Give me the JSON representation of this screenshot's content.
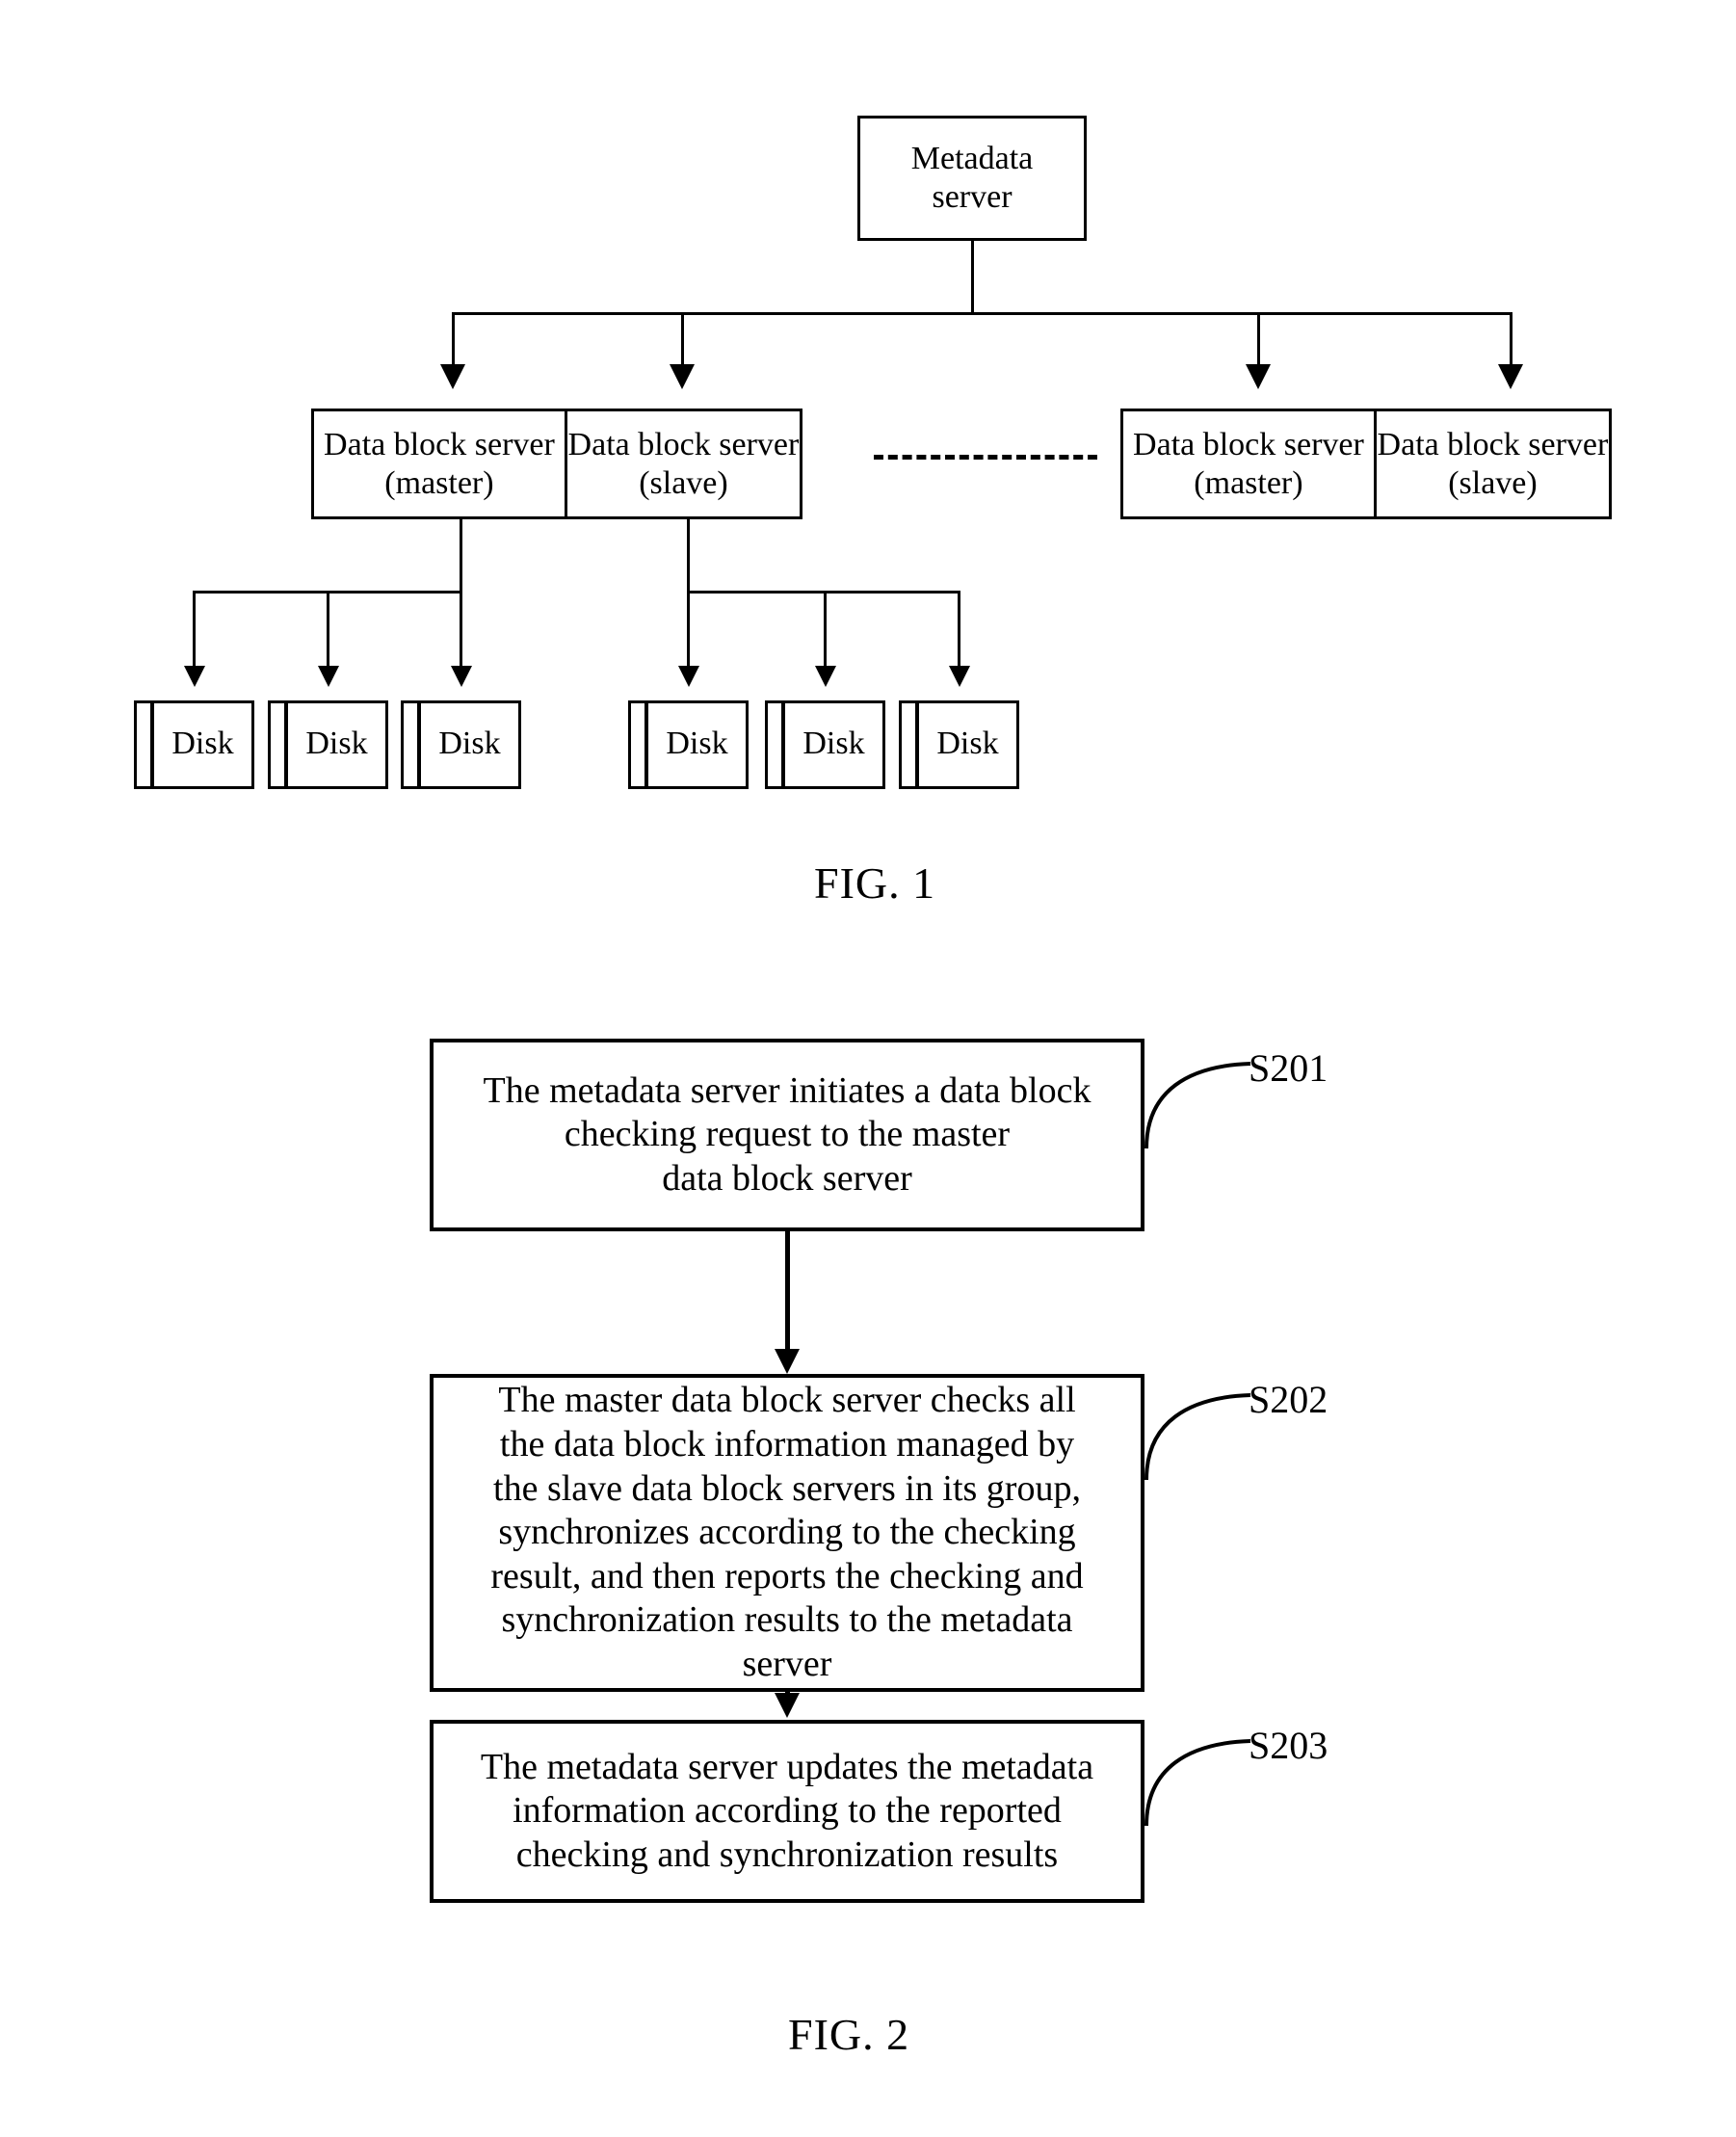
{
  "figure1": {
    "caption": "FIG. 1",
    "root": {
      "label": "Metadata\nserver"
    },
    "group_left": {
      "master": {
        "label": "Data block\nserver (master)"
      },
      "slave": {
        "label": "Data block\nserver (slave)"
      }
    },
    "group_right": {
      "master": {
        "label": "Data block\nserver (master)"
      },
      "slave": {
        "label": "Data block\nserver (slave)"
      }
    },
    "ellipsis": "- - - - - - - -",
    "disks_left": [
      {
        "label": "Disk"
      },
      {
        "label": "Disk"
      },
      {
        "label": "Disk"
      }
    ],
    "disks_right": [
      {
        "label": "Disk"
      },
      {
        "label": "Disk"
      },
      {
        "label": "Disk"
      }
    ]
  },
  "figure2": {
    "caption": "FIG. 2",
    "steps": [
      {
        "id": "S201",
        "text": "The metadata server initiates a data block\nchecking request to the master\ndata block server"
      },
      {
        "id": "S202",
        "text": "The master data block server checks all\nthe data block information managed by\nthe slave data block servers in its group,\nsynchronizes according to the checking\nresult, and then reports the checking and\nsynchronization results to the metadata\nserver"
      },
      {
        "id": "S203",
        "text": "The metadata server updates the metadata\ninformation according to the reported\nchecking and synchronization results"
      }
    ]
  }
}
